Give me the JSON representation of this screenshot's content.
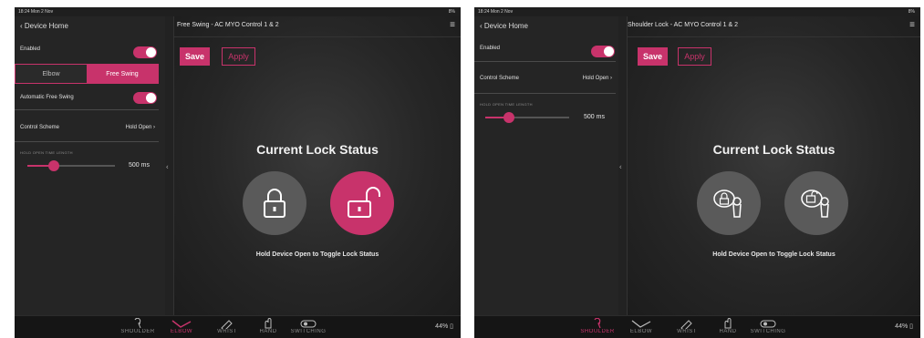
{
  "left": {
    "status": {
      "time": "18:24  Mon 2 Nov",
      "battery": "8%"
    },
    "back_label": "Device Home",
    "title": "Free Swing - AC MYO Control 1 & 2",
    "enabled_label": "Enabled",
    "segments": [
      "Elbow",
      "Free Swing"
    ],
    "selected_segment": "Free Swing",
    "auto_free_swing_label": "Automatic Free Swing",
    "control_scheme_label": "Control Scheme",
    "control_scheme_value": "Hold Open",
    "hold_open_label": "HOLD OPEN TIME LENGTH",
    "slider_fraction": 0.3,
    "slider_value": "500 ms",
    "save_label": "Save",
    "apply_label": "Apply",
    "lock_title": "Current Lock Status",
    "hint": "Hold Device Open to Toggle Lock Status",
    "lock_state": "unlocked",
    "tabs": [
      "SHOULDER",
      "ELBOW",
      "WRIST",
      "HAND",
      "SWITCHING"
    ],
    "active_tab": "ELBOW",
    "battery_pct": "44%"
  },
  "right": {
    "status": {
      "time": "18:24  Mon 2 Nov",
      "battery": "8%"
    },
    "back_label": "Device Home",
    "title": "Shoulder Lock - AC MYO Control 1 & 2",
    "enabled_label": "Enabled",
    "control_scheme_label": "Control Scheme",
    "control_scheme_value": "Hold Open",
    "hold_open_label": "HOLD OPEN TIME LENGTH",
    "slider_fraction": 0.3,
    "slider_value": "500 ms",
    "save_label": "Save",
    "apply_label": "Apply",
    "lock_title": "Current Lock Status",
    "hint": "Hold Device Open to Toggle Lock Status",
    "tabs": [
      "SHOULDER",
      "ELBOW",
      "WRIST",
      "HAND",
      "SWITCHING"
    ],
    "active_tab": "SHOULDER",
    "battery_pct": "44%"
  },
  "colors": {
    "accent": "#c8336b",
    "panel": "#252525",
    "background": "#1f1f1f",
    "inactive_circle": "#5a5a5a"
  },
  "icons": {
    "tabs": [
      "shoulder-icon",
      "elbow-icon",
      "wrist-icon",
      "hand-icon",
      "switching-icon"
    ],
    "left_circles": [
      "padlock-closed-icon",
      "padlock-open-icon"
    ],
    "right_circles": [
      "shoulder-locked-icon",
      "shoulder-unlocked-icon"
    ]
  }
}
